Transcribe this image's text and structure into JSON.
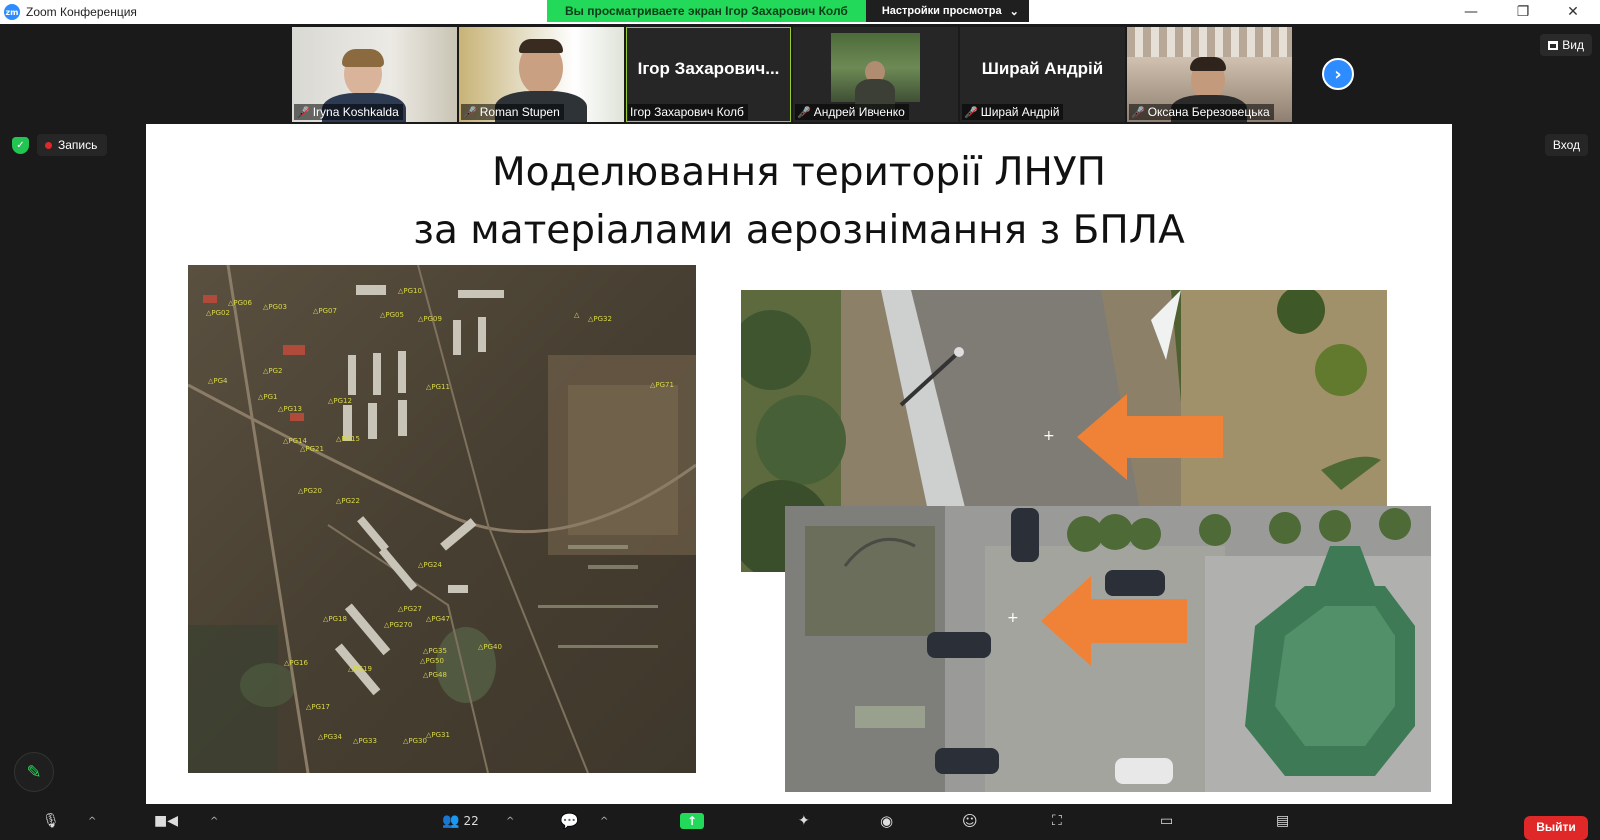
{
  "window": {
    "app_title": "Zoom Конференция",
    "logo_text": "zm",
    "share_banner": "Вы просматриваете экран Ігор Захарович Колб",
    "view_settings": "Настройки просмотра"
  },
  "participants": [
    {
      "name": "Iryna Koshkalda",
      "video": true,
      "muted": true
    },
    {
      "name": "Roman Stupen",
      "video": true,
      "muted": true
    },
    {
      "name": "Ігор Захарович Колб",
      "big_name": "Ігор Захарович...",
      "video": false,
      "muted": false,
      "active": true
    },
    {
      "name": "Андрей Ивченко",
      "video": true,
      "muted": true
    },
    {
      "name": "Ширай Андрій",
      "big_name": "Ширай Андрій",
      "video": false,
      "muted": true
    },
    {
      "name": "Оксана Березовецька",
      "video": true,
      "muted": true
    }
  ],
  "controls": {
    "view_label": "Вид",
    "recording_label": "Запись",
    "login_label": "Вход",
    "participants_count": "22",
    "leave_label": "Выйти"
  },
  "slide": {
    "title_line1": "Моделювання території ЛНУП",
    "title_line2": "за матеріалами аерознімання з БПЛА"
  },
  "colors": {
    "share_green": "#23d959",
    "zoom_blue": "#2d8cff",
    "leave_red": "#e02828",
    "arrow_orange": "#f08237"
  }
}
